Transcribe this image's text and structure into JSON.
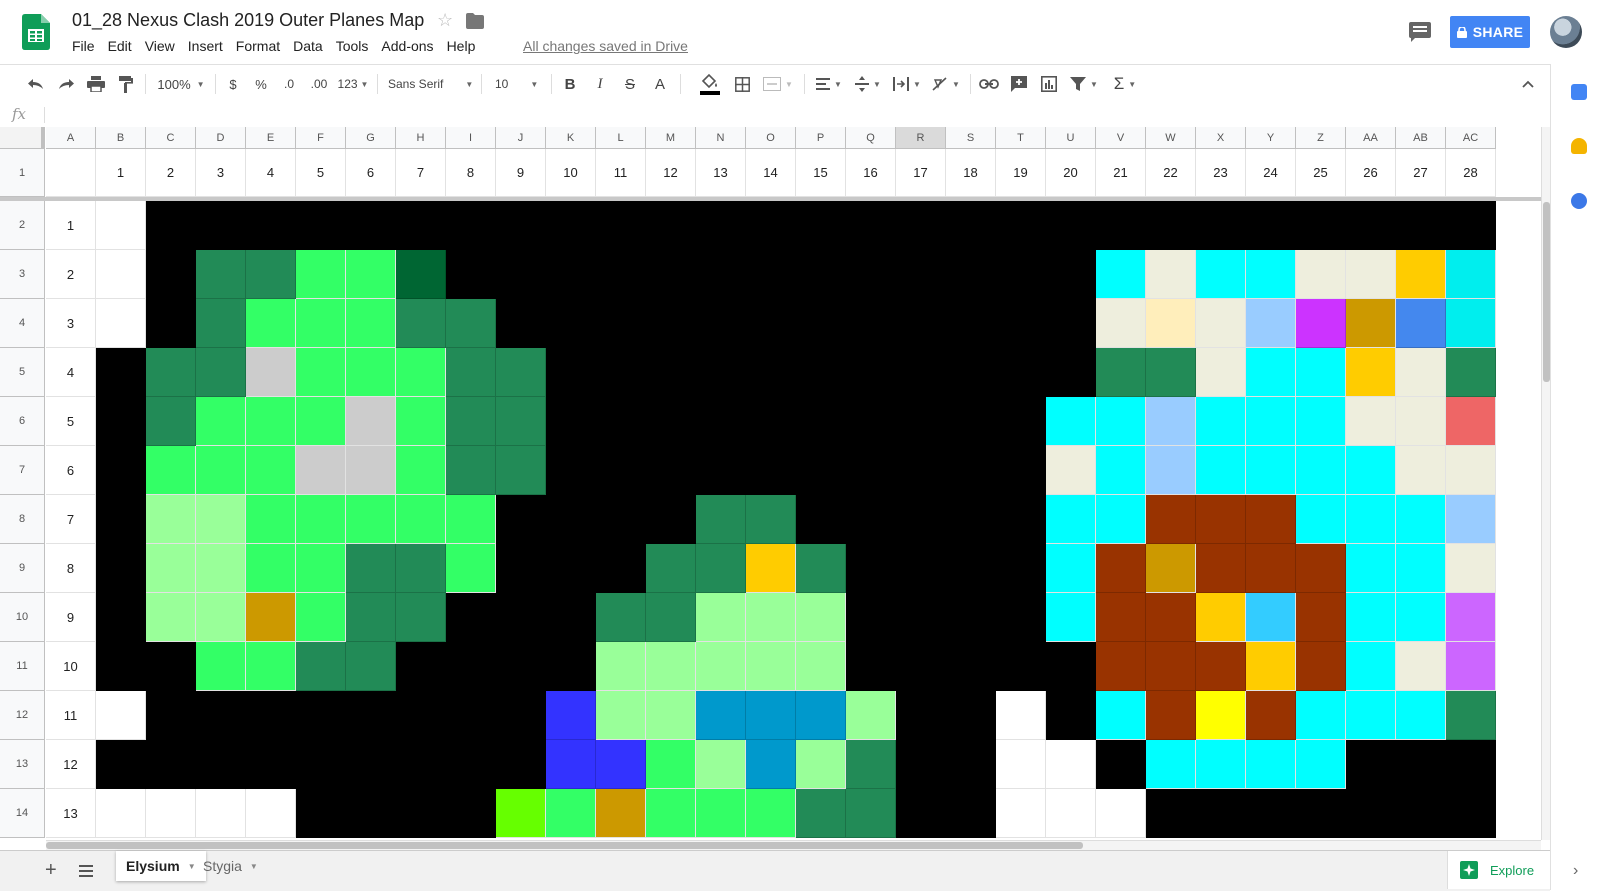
{
  "document": {
    "title": "01_28 Nexus Clash 2019 Outer Planes Map",
    "save_status": "All changes saved in Drive"
  },
  "menu": [
    "File",
    "Edit",
    "View",
    "Insert",
    "Format",
    "Data",
    "Tools",
    "Add-ons",
    "Help"
  ],
  "header": {
    "share_label": "SHARE"
  },
  "toolbar": {
    "zoom": "100%",
    "currency_label": "$",
    "percent_label": "%",
    "decrease_decimals_label": ".0",
    "increase_decimals_label": ".00",
    "more_formats_label": "123",
    "font": "Sans Serif",
    "font_size": "10",
    "bold_label": "B",
    "italic_label": "I",
    "strike_label": "S",
    "text_color_label": "A"
  },
  "formula_bar": {
    "fx_label": "fx"
  },
  "grid": {
    "columns": [
      "A",
      "B",
      "C",
      "D",
      "E",
      "F",
      "G",
      "H",
      "I",
      "J",
      "K",
      "L",
      "M",
      "N",
      "O",
      "P",
      "Q",
      "R",
      "S",
      "T",
      "U",
      "V",
      "W",
      "X",
      "Y",
      "Z",
      "AA",
      "AB",
      "AC"
    ],
    "selected_column": "R",
    "row_numbers": [
      "1",
      "2",
      "3",
      "4",
      "5",
      "6",
      "7",
      "8",
      "9",
      "10",
      "11",
      "12",
      "13",
      "14"
    ],
    "header_row_values": [
      "",
      "1",
      "2",
      "3",
      "4",
      "5",
      "6",
      "7",
      "8",
      "9",
      "10",
      "11",
      "12",
      "13",
      "14",
      "15",
      "16",
      "17",
      "18",
      "19",
      "20",
      "21",
      "22",
      "23",
      "24",
      "25",
      "26",
      "27",
      "28"
    ],
    "map_rows": [
      [
        "W",
        "K",
        "K",
        "K",
        "K",
        "K",
        "K",
        "K",
        "K",
        "K",
        "K",
        "K",
        "K",
        "K",
        "K",
        "K",
        "K",
        "K",
        "K",
        "K",
        "K",
        "K",
        "K",
        "K",
        "K",
        "K",
        "K",
        "K"
      ],
      [
        "W",
        "K",
        "g",
        "g",
        "G",
        "G",
        "s",
        "K",
        "K",
        "K",
        "K",
        "K",
        "K",
        "K",
        "K",
        "K",
        "K",
        "K",
        "K",
        "K",
        "c",
        "e",
        "c",
        "c",
        "e",
        "e",
        "o",
        "t"
      ],
      [
        "W",
        "K",
        "g",
        "G",
        "G",
        "G",
        "g",
        "g",
        "K",
        "K",
        "K",
        "K",
        "K",
        "K",
        "K",
        "K",
        "K",
        "K",
        "K",
        "K",
        "e",
        "y",
        "e",
        "l",
        "p",
        "u",
        "b",
        "t"
      ],
      [
        "K",
        "g",
        "g",
        "x",
        "G",
        "G",
        "G",
        "g",
        "g",
        "K",
        "K",
        "K",
        "K",
        "K",
        "K",
        "K",
        "K",
        "K",
        "K",
        "K",
        "g",
        "g",
        "e",
        "c",
        "c",
        "o",
        "e",
        "g"
      ],
      [
        "K",
        "g",
        "G",
        "G",
        "G",
        "x",
        "G",
        "g",
        "g",
        "K",
        "K",
        "K",
        "K",
        "K",
        "K",
        "K",
        "K",
        "K",
        "K",
        "c",
        "c",
        "l",
        "c",
        "c",
        "c",
        "e",
        "e",
        "r"
      ],
      [
        "K",
        "G",
        "G",
        "G",
        "x",
        "x",
        "G",
        "g",
        "g",
        "K",
        "K",
        "K",
        "K",
        "K",
        "K",
        "K",
        "K",
        "K",
        "K",
        "e",
        "c",
        "l",
        "c",
        "c",
        "c",
        "c",
        "e",
        "e"
      ],
      [
        "K",
        "L",
        "L",
        "G",
        "G",
        "G",
        "G",
        "G",
        "K",
        "K",
        "K",
        "K",
        "g",
        "g",
        "K",
        "K",
        "K",
        "K",
        "K",
        "c",
        "c",
        "R",
        "R",
        "R",
        "c",
        "c",
        "c",
        "l"
      ],
      [
        "K",
        "L",
        "L",
        "G",
        "G",
        "g",
        "g",
        "G",
        "K",
        "K",
        "K",
        "g",
        "g",
        "o",
        "g",
        "K",
        "K",
        "K",
        "K",
        "c",
        "R",
        "u",
        "R",
        "R",
        "R",
        "c",
        "c",
        "e"
      ],
      [
        "K",
        "L",
        "L",
        "u",
        "G",
        "g",
        "g",
        "K",
        "K",
        "K",
        "g",
        "g",
        "L",
        "L",
        "L",
        "K",
        "K",
        "K",
        "K",
        "c",
        "R",
        "R",
        "o",
        "a",
        "R",
        "c",
        "c",
        "v"
      ],
      [
        "K",
        "K",
        "G",
        "G",
        "g",
        "g",
        "K",
        "K",
        "K",
        "K",
        "L",
        "L",
        "L",
        "L",
        "L",
        "K",
        "K",
        "K",
        "K",
        "K",
        "R",
        "R",
        "R",
        "o",
        "R",
        "c",
        "e",
        "v"
      ],
      [
        "W",
        "K",
        "K",
        "K",
        "K",
        "K",
        "K",
        "K",
        "K",
        "B",
        "L",
        "L",
        "m",
        "m",
        "m",
        "L",
        "K",
        "K",
        "W",
        "K",
        "c",
        "R",
        "Y",
        "R",
        "c",
        "c",
        "c",
        "g"
      ],
      [
        "K",
        "K",
        "K",
        "K",
        "K",
        "K",
        "K",
        "K",
        "K",
        "B",
        "B",
        "G",
        "L",
        "m",
        "L",
        "g",
        "K",
        "K",
        "W",
        "W",
        "K",
        "c",
        "c",
        "c",
        "c",
        "K",
        "K",
        "K"
      ],
      [
        "W",
        "W",
        "W",
        "W",
        "K",
        "K",
        "K",
        "K",
        "N",
        "G",
        "u",
        "G",
        "G",
        "G",
        "g",
        "g",
        "K",
        "K",
        "W",
        "W",
        "W",
        "K",
        "K",
        "K",
        "K",
        "K",
        "K",
        "K"
      ]
    ]
  },
  "palette": {
    "W": "#ffffff",
    "K": "#000000",
    "g": "#228b57",
    "G": "#33ff66",
    "L": "#99ff99",
    "s": "#006633",
    "x": "#cccccc",
    "u": "#cc9900",
    "o": "#ffcc00",
    "c": "#00ffff",
    "e": "#eeeedd",
    "y": "#ffeebb",
    "l": "#99ccff",
    "p": "#cc33ff",
    "b": "#4488ee",
    "t": "#00eeee",
    "r": "#ee6666",
    "R": "#993300",
    "a": "#33ccff",
    "Y": "#ffff00",
    "v": "#cc66ff",
    "B": "#3333ff",
    "m": "#0099cc",
    "N": "#66ff00"
  },
  "sheets": [
    {
      "name": "Elysium",
      "active": true
    },
    {
      "name": "Stygia",
      "active": false
    }
  ],
  "explore_label": "Explore"
}
